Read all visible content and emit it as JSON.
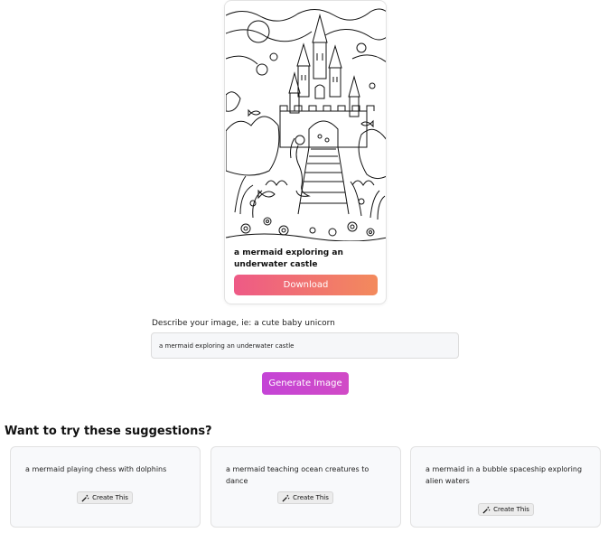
{
  "result": {
    "image_alt": "coloring page of a mermaid exploring an underwater castle",
    "caption": "a mermaid exploring an underwater castle",
    "download_label": "Download",
    "download_gradient": [
      "#ee5a86",
      "#f38a5c"
    ]
  },
  "form": {
    "label": "Describe your image, ie: a cute baby unicorn",
    "input_value": "a mermaid exploring an underwater castle",
    "generate_label": "Generate Image",
    "generate_color": "#c94ad2"
  },
  "suggestions": {
    "heading": "Want to try these suggestions?",
    "items": [
      {
        "text": "a mermaid playing chess with dolphins",
        "button_label": "Create This",
        "icon": "magic-wand-icon"
      },
      {
        "text": "a mermaid teaching ocean creatures to dance",
        "button_label": "Create This",
        "icon": "magic-wand-icon"
      },
      {
        "text": "a mermaid in a bubble spaceship exploring alien waters",
        "button_label": "Create This",
        "icon": "magic-wand-icon"
      }
    ]
  }
}
